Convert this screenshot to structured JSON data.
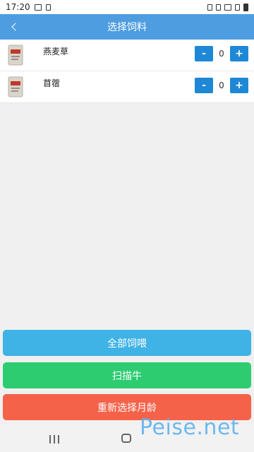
{
  "status_bar": {
    "time": "17:20"
  },
  "header": {
    "title": "选择饲料"
  },
  "feeds": [
    {
      "name": "燕麦草",
      "quantity": "0"
    },
    {
      "name": "苜蓿",
      "quantity": "0"
    }
  ],
  "stepper": {
    "minus_label": "-",
    "plus_label": "+"
  },
  "actions": {
    "feed_all": "全部饲喂",
    "scan_cow": "扫描牛",
    "reselect_month": "重新选择月龄"
  },
  "watermark": "Peise.net",
  "colors": {
    "header_bg": "#4e9de0",
    "stepper_btn": "#1e88d6",
    "feed_all_btn": "#3fb2e6",
    "scan_btn": "#2ecc71",
    "reselect_btn": "#f5624a"
  },
  "icons": {
    "back": "chevron-left-icon",
    "feed_bag": "feed-bag-icon"
  }
}
